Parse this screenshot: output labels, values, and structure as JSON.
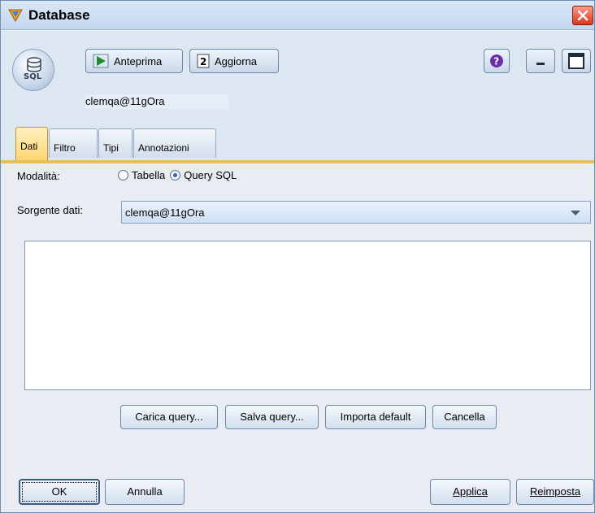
{
  "window": {
    "title": "Database"
  },
  "toolbar": {
    "preview_label": "Anteprima",
    "refresh_label": "Aggiorna",
    "connection": "clemqa@11gOra"
  },
  "node_icon": {
    "caption": "SQL"
  },
  "tabs": [
    {
      "label": "Dati",
      "active": true
    },
    {
      "label": "Filtro",
      "active": false
    },
    {
      "label": "Tipi",
      "active": false
    },
    {
      "label": "Annotazioni",
      "active": false
    }
  ],
  "form": {
    "mode_label": "Modalità:",
    "mode_options": [
      {
        "label": "Tabella",
        "selected": false
      },
      {
        "label": "Query SQL",
        "selected": true
      }
    ],
    "source_label": "Sorgente dati:",
    "source_value": "clemqa@11gOra",
    "query_text": ""
  },
  "query_buttons": {
    "load": "Carica query...",
    "save": "Salva query...",
    "import_default": "Importa default",
    "clear": "Cancella"
  },
  "footer": {
    "ok": "OK",
    "cancel": "Annulla",
    "apply": "Applica",
    "reset": "Reimposta"
  },
  "colors": {
    "active_tab": "#ffd770",
    "tab_rule": "#e8bf55",
    "close_button": "#d9361b"
  }
}
